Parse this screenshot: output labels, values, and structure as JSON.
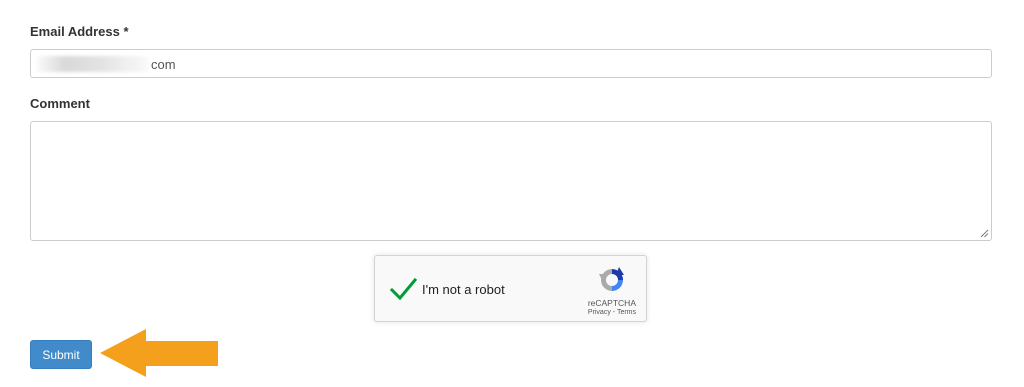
{
  "form": {
    "email_label": "Email Address *",
    "email_value_suffix": "com",
    "comment_label": "Comment",
    "comment_value": "",
    "submit_label": "Submit"
  },
  "recaptcha": {
    "label": "I'm not a robot",
    "brand": "reCAPTCHA",
    "privacy": "Privacy",
    "separator": " - ",
    "terms": "Terms",
    "checked": true
  },
  "colors": {
    "primary_button": "#428bca",
    "checkmark": "#009d37",
    "annotation_arrow": "#f5a01d"
  },
  "icons": {
    "captcha_check": "check-icon",
    "captcha_logo": "recaptcha-logo-icon",
    "annotation": "arrow-left-icon"
  }
}
